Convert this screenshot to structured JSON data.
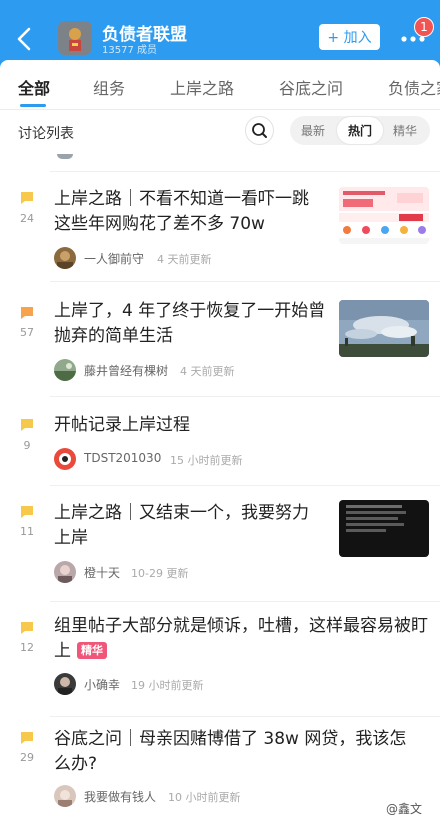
{
  "header": {
    "group_name": "负债者联盟",
    "member_count": "13577 成员",
    "join_label": "+ 加入",
    "notification_count": "1",
    "accent_color": "#2d9cf0"
  },
  "tabs": [
    {
      "label": "全部"
    },
    {
      "label": "组务"
    },
    {
      "label": "上岸之路"
    },
    {
      "label": "谷底之问"
    },
    {
      "label": "负债之家"
    }
  ],
  "toolbar": {
    "title": "讨论列表",
    "sort_options": [
      {
        "label": "最新"
      },
      {
        "label": "热门"
      },
      {
        "label": "精华"
      }
    ]
  },
  "posts": [
    {
      "title": "上岸之路｜不看不知道一看吓一跳这些年网购花了差不多 70w",
      "count": "24",
      "author": "一人御前守",
      "time": "4 天前更新",
      "flag_color": "#f6c84c",
      "thumbnail": "app-screenshot"
    },
    {
      "title": "上岸了，4 年了终于恢复了一开始曾抛弃的简单生活",
      "count": "57",
      "author": "藤井曾经有棵树",
      "time": "4 天前更新",
      "flag_color": "#f7a24c",
      "thumbnail": "sky-photo"
    },
    {
      "title": "开帖记录上岸过程",
      "count": "9",
      "author": "TDST201030",
      "time": "15 小时前更新",
      "flag_color": "#f6c84c"
    },
    {
      "title": "上岸之路｜又结束一个，我要努力上岸",
      "count": "11",
      "author": "橙十天",
      "time": "10-29 更新",
      "flag_color": "#f6c84c",
      "thumbnail": "dark-screenshot"
    },
    {
      "title": "组里帖子大部分就是倾诉，吐槽，这样最容易被盯上",
      "tag": "精华",
      "count": "12",
      "author": "小确幸",
      "time": "19 小时前更新",
      "flag_color": "#f6c84c"
    },
    {
      "title": "谷底之问｜母亲因赌博借了 38w 网贷，我该怎么办?",
      "count": "29",
      "author": "我要做有钱人",
      "time": "10 小时前更新",
      "flag_color": "#f6c84c"
    }
  ],
  "watermark": "@鑫文"
}
